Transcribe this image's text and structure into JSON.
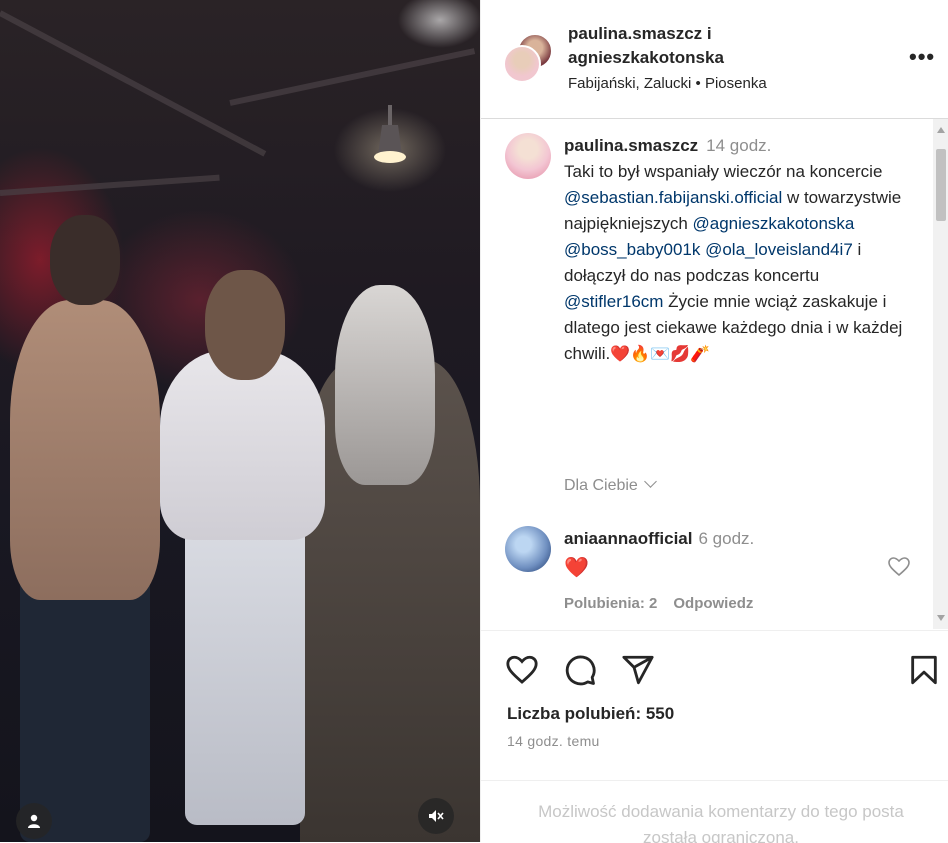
{
  "header": {
    "title_line1": "paulina.smaszcz i",
    "title_line2": "agnieszkakotonska",
    "audio": "Fabijański, Zalucki • Piosenka",
    "more_icon": "more-horizontal-icon"
  },
  "caption": {
    "username": "paulina.smaszcz",
    "time": "14 godz.",
    "text_1": "Taki to był wspaniały wieczór na koncercie ",
    "mention_1": "@sebastian.fabijanski.official",
    "text_2": " w towarzystwie najpiękniejszych ",
    "mention_2": "@agnieszkakotonska",
    "mention_3": "@boss_baby001k",
    "mention_4": "@ola_loveisland4i7",
    "text_3": " i dołączył do nas podczas koncertu ",
    "mention_5": "@stifler16cm",
    "text_4": " Życie mnie wciąż zaskakuje i dlatego jest ciekawe każdego dnia i w każdej chwili.",
    "emojis": "❤️🔥💌💋🧨",
    "for_you": "Dla Ciebie"
  },
  "comment": {
    "username": "aniaannaofficial",
    "time": "6 godz.",
    "text": "❤️",
    "likes": "Polubienia: 2",
    "reply": "Odpowiedz"
  },
  "actions": {
    "like_icon": "heart-icon",
    "comment_icon": "comment-icon",
    "share_icon": "send-icon",
    "save_icon": "bookmark-icon"
  },
  "likes": "Liczba polubień: 550",
  "date": "14 godz. temu",
  "footer": "Możliwość dodawania komentarzy do tego posta została ograniczona."
}
